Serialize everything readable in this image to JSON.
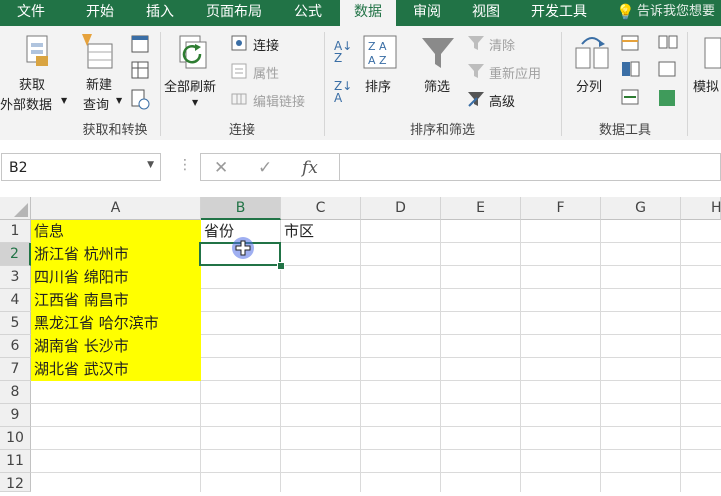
{
  "ribbon_tabs": [
    "文件",
    "开始",
    "插入",
    "页面布局",
    "公式",
    "数据",
    "审阅",
    "视图",
    "开发工具"
  ],
  "active_tab": "数据",
  "tell_me": "告诉我您想要",
  "groups": {
    "get_transform": {
      "label": "获取和转换",
      "get_external_1": "获取",
      "get_external_2": "外部数据",
      "new_query_1": "新建",
      "new_query_2": "查询"
    },
    "connections": {
      "label": "连接",
      "refresh_all": "全部刷新",
      "connections": "连接",
      "properties": "属性",
      "edit_links": "编辑链接"
    },
    "sort_filter": {
      "label": "排序和筛选",
      "sort": "排序",
      "filter": "筛选",
      "clear": "清除",
      "reapply": "重新应用",
      "advanced": "高级"
    },
    "data_tools": {
      "label": "数据工具",
      "text_to_columns": "分列"
    },
    "forecast": {
      "what_if": "模拟"
    }
  },
  "formula_bar": {
    "name_box": "B2",
    "cancel": "✕",
    "enter": "✓",
    "fx": "fx",
    "content": ""
  },
  "columns": [
    "A",
    "B",
    "C",
    "D",
    "E",
    "F",
    "G",
    "H"
  ],
  "rows": [
    "1",
    "2",
    "3",
    "4",
    "5",
    "6",
    "7",
    "8",
    "9",
    "10",
    "11",
    "12"
  ],
  "cells": {
    "A1": "信息",
    "A2": "浙江省 杭州市",
    "A3": "四川省 绵阳市",
    "A4": "江西省 南昌市",
    "A5": "黑龙江省 哈尔滨市",
    "A6": "湖南省 长沙市",
    "A7": "湖北省 武汉市",
    "B1": "省份",
    "C1": "市区"
  },
  "selected_cell": "B2",
  "colors": {
    "ribbon_green": "#217346",
    "highlight_yellow": "#ffff00"
  }
}
